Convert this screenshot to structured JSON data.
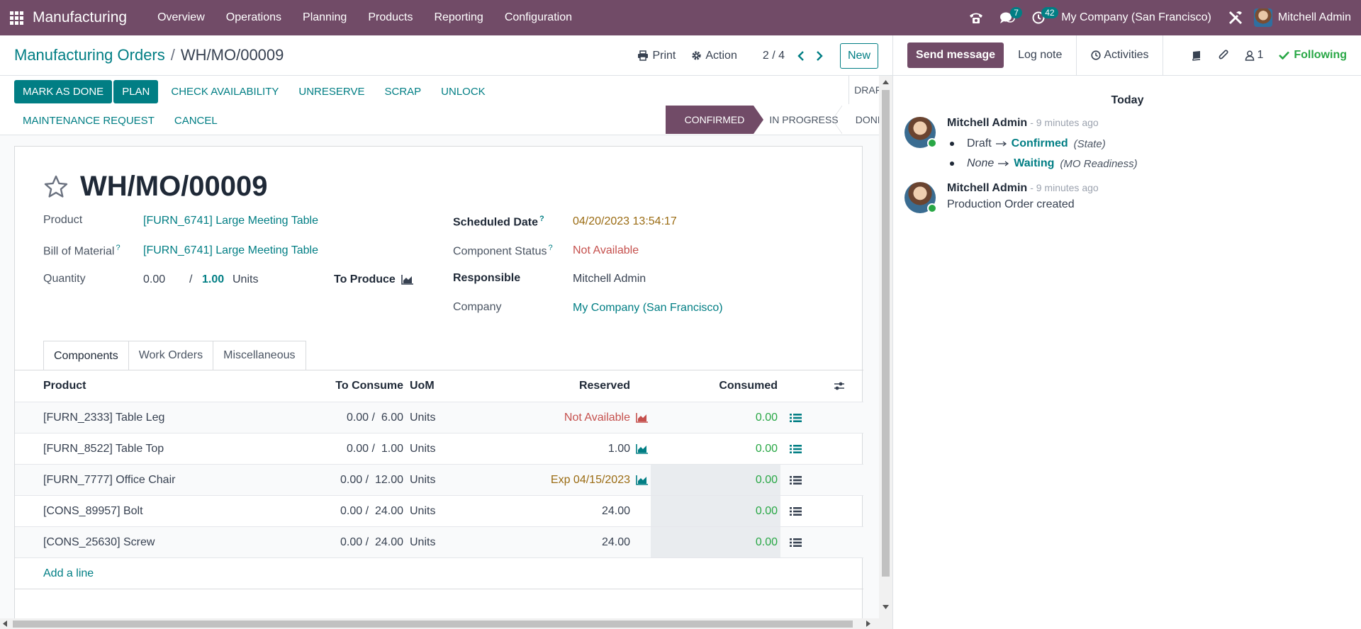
{
  "navbar": {
    "app_name": "Manufacturing",
    "menu": [
      "Overview",
      "Operations",
      "Planning",
      "Products",
      "Reporting",
      "Configuration"
    ],
    "messages_count": "7",
    "activities_count": "42",
    "company": "My Company (San Francisco)",
    "user": "Mitchell Admin"
  },
  "control": {
    "breadcrumb_parent": "Manufacturing Orders",
    "breadcrumb_sep": "/",
    "breadcrumb_current": "WH/MO/00009",
    "print_label": "Print",
    "action_label": "Action",
    "pager": "2 / 4",
    "new_label": "New"
  },
  "status": {
    "buttons_row1": [
      "MARK AS DONE",
      "PLAN",
      "CHECK AVAILABILITY",
      "UNRESERVE",
      "SCRAP",
      "UNLOCK"
    ],
    "buttons_row2": [
      "MAINTENANCE REQUEST",
      "CANCEL"
    ],
    "stage_draft": "DRAFT",
    "stage_confirmed": "CONFIRMED",
    "stage_in_progress": "IN PROGRESS",
    "stage_done": "DONE"
  },
  "form": {
    "title": "WH/MO/00009",
    "product_label": "Product",
    "product_value": "[FURN_6741] Large Meeting Table",
    "bom_label": "Bill of Material",
    "bom_value": "[FURN_6741] Large Meeting Table",
    "quantity_label": "Quantity",
    "quantity_done": "0.00",
    "quantity_sep": "/",
    "quantity_total": "1.00",
    "quantity_uom": "Units",
    "to_produce_label": "To Produce",
    "scheduled_label": "Scheduled Date",
    "scheduled_value": "04/20/2023 13:54:17",
    "component_status_label": "Component Status",
    "component_status_value": "Not Available",
    "responsible_label": "Responsible",
    "responsible_value": "Mitchell Admin",
    "company_label": "Company",
    "company_value": "My Company (San Francisco)",
    "help_mark": "?"
  },
  "tabs": [
    "Components",
    "Work Orders",
    "Miscellaneous"
  ],
  "components": {
    "headers": {
      "product": "Product",
      "to_consume": "To Consume",
      "uom": "UoM",
      "reserved": "Reserved",
      "consumed": "Consumed"
    },
    "rows": [
      {
        "product": "[FURN_2333] Table Leg",
        "to_consume": "0.00 /  6.00",
        "uom": "Units",
        "reserved": "Not Available",
        "consumed": "0.00"
      },
      {
        "product": "[FURN_8522] Table Top",
        "to_consume": "0.00 /  1.00",
        "uom": "Units",
        "reserved": "1.00",
        "consumed": "0.00"
      },
      {
        "product": "[FURN_7777] Office Chair",
        "to_consume": "0.00 /  12.00",
        "uom": "Units",
        "reserved": "Exp 04/15/2023",
        "consumed": "0.00"
      },
      {
        "product": "[CONS_89957] Bolt",
        "to_consume": "0.00 /  24.00",
        "uom": "Units",
        "reserved": "24.00",
        "consumed": "0.00"
      },
      {
        "product": "[CONS_25630] Screw",
        "to_consume": "0.00 /  24.00",
        "uom": "Units",
        "reserved": "24.00",
        "consumed": "0.00"
      }
    ],
    "add_line": "Add a line"
  },
  "chatter": {
    "send_message": "Send message",
    "log_note": "Log note",
    "activities": "Activities",
    "followers_count": "1",
    "following": "Following",
    "today": "Today",
    "messages": [
      {
        "author": "Mitchell Admin",
        "when": "- 9 minutes ago",
        "tracking": [
          {
            "old": "Draft",
            "new": "Confirmed",
            "field": "(State)"
          },
          {
            "old": "None",
            "new": "Waiting",
            "field": "(MO Readiness)"
          }
        ]
      },
      {
        "author": "Mitchell Admin",
        "when": "- 9 minutes ago",
        "body": "Production Order created"
      }
    ]
  },
  "colors": {
    "brand": "#714b67",
    "accent": "#017e84",
    "success": "#28a745",
    "danger": "#c5504d",
    "warning": "#9a6b12"
  }
}
